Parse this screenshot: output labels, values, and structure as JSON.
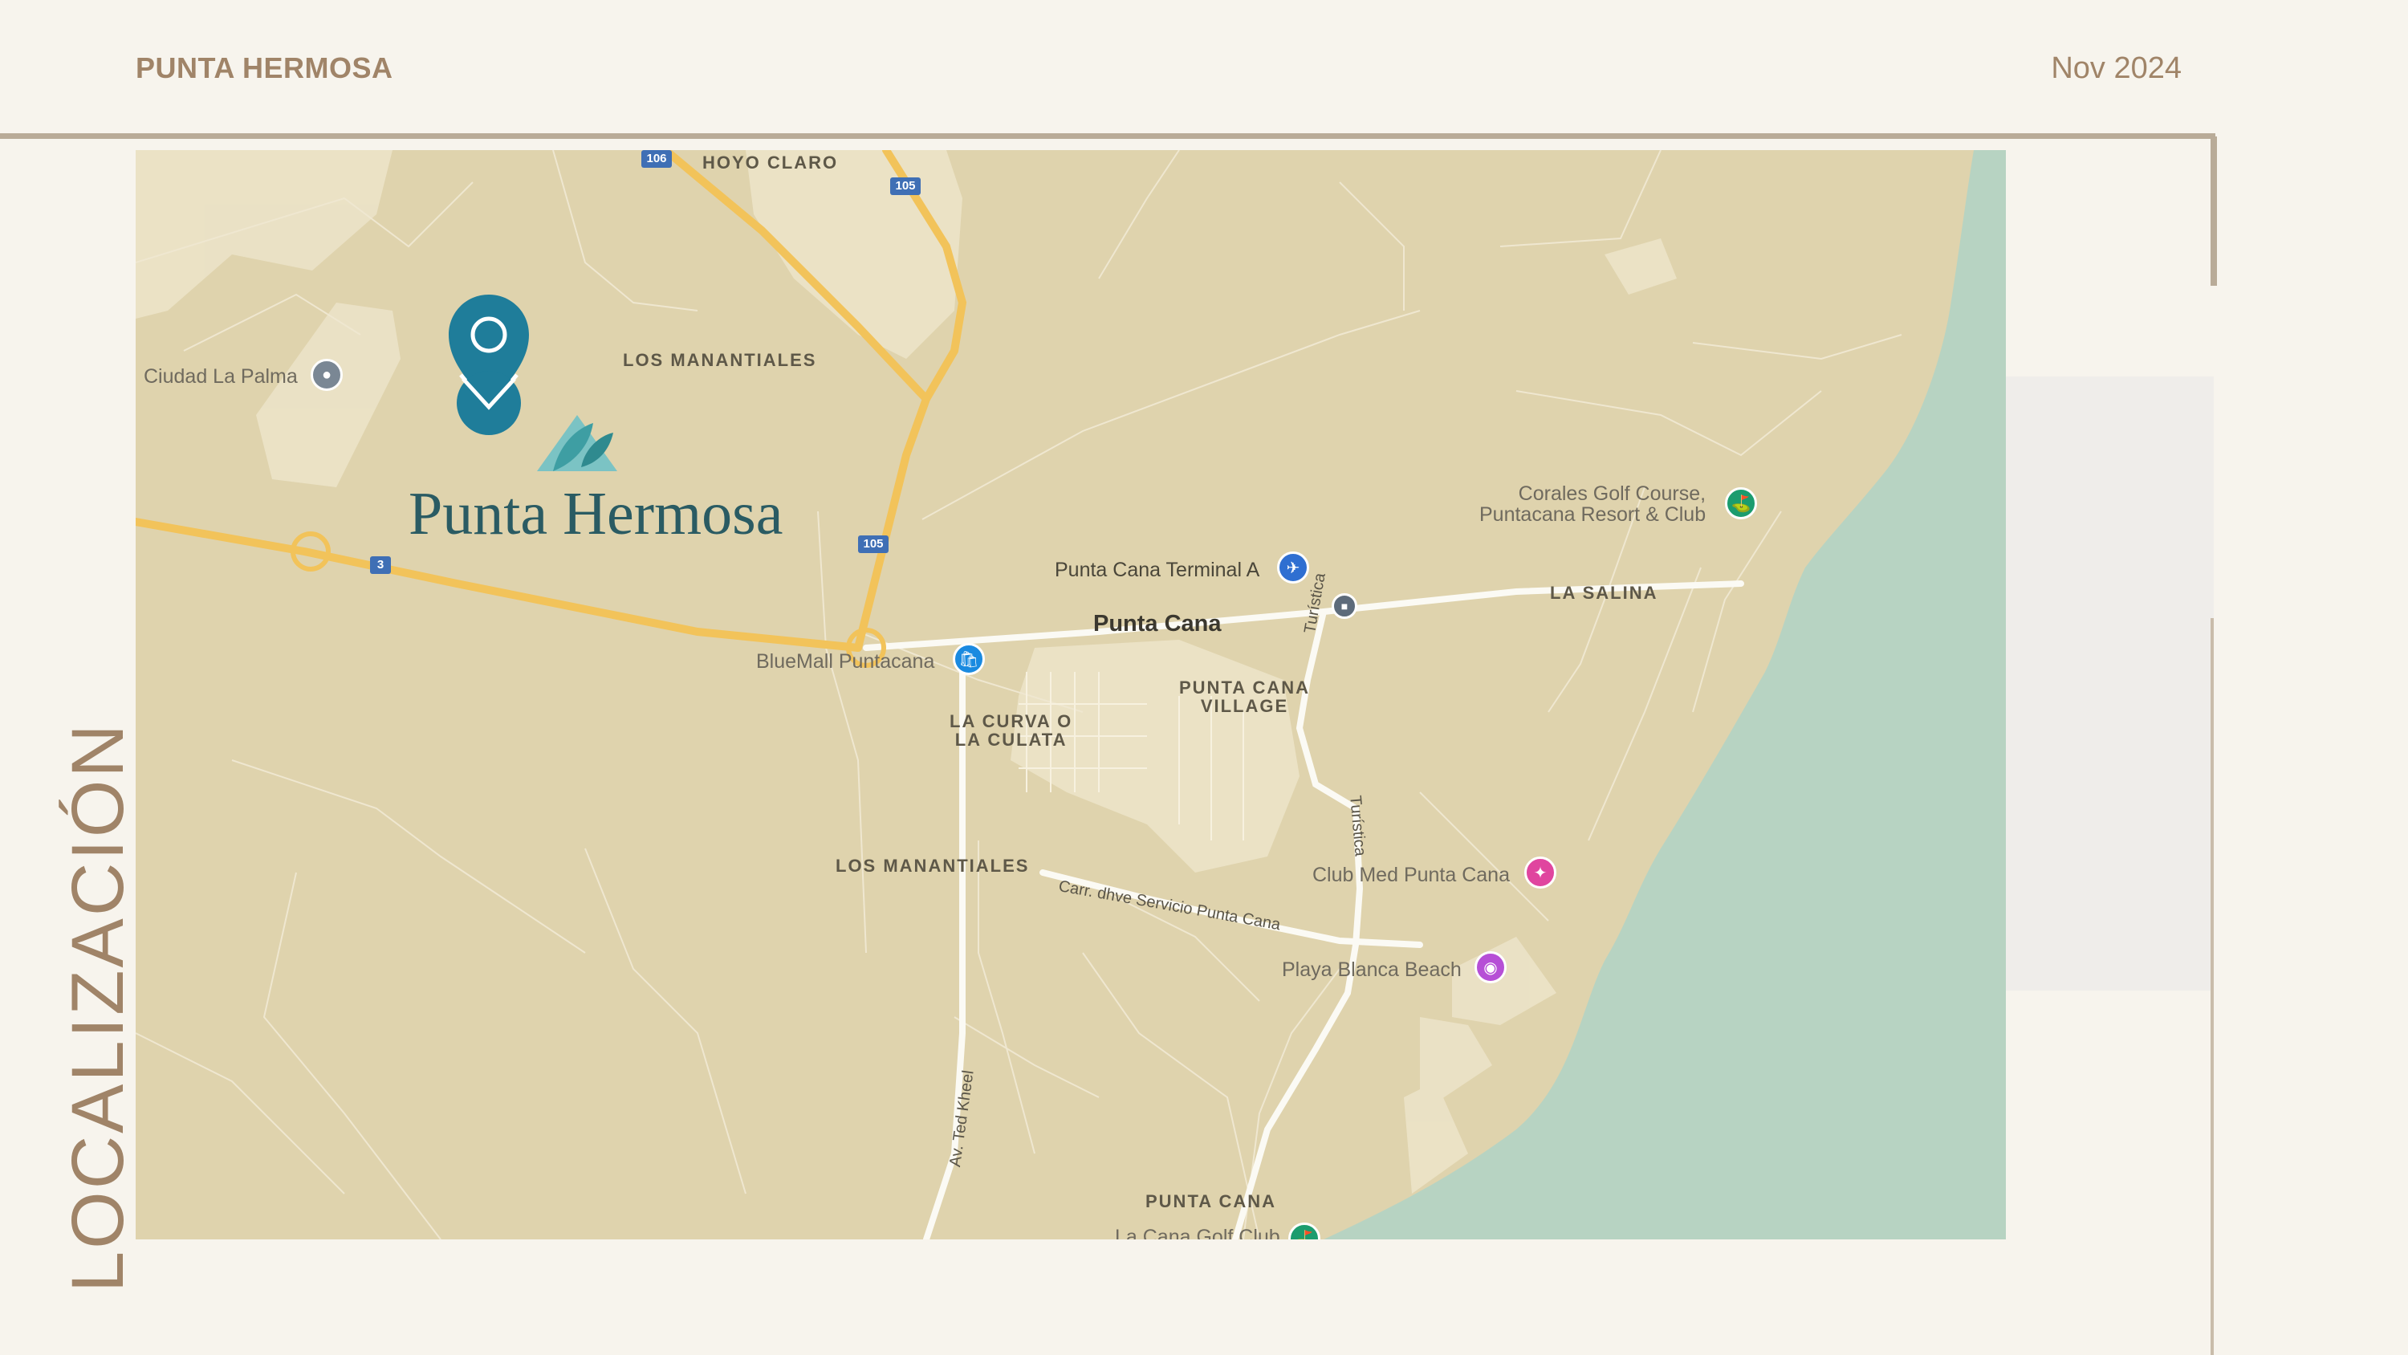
{
  "header": {
    "brand": "PUNTA HERMOSA",
    "date": "Nov 2024"
  },
  "side_title": "LOCALIZACIÓN",
  "map": {
    "logo_text": "Punta Hermosa",
    "areas": {
      "hoyo_claro": "HOYO CLARO",
      "los_manantiales_top": "LOS MANANTIALES",
      "la_salina": "LA SALINA",
      "punta_cana_village_1": "PUNTA CANA",
      "punta_cana_village_2": "VILLAGE",
      "la_curva_1": "LA CURVA O",
      "la_curva_2": "LA CULATA",
      "los_manantiales_bottom": "LOS MANANTIALES",
      "punta_cana_area": "PUNTA CANA"
    },
    "city": "Punta Cana",
    "pois": {
      "ciudad_la_palma": "Ciudad La Palma",
      "airport": "Punta Cana Terminal A",
      "bluemall": "BlueMall Puntacana",
      "golf_1": "Corales Golf Course,",
      "golf_2": "Puntacana Resort & Club",
      "club_med": "Club Med Punta Cana",
      "playa_blanca": "Playa Blanca Beach",
      "golf_bottom": "La Cana Golf Club"
    },
    "roads": {
      "turistica_1": "Turística",
      "turistica_2": "Turística",
      "carr_servicio": "Carr. dhve Servicio Punta Cana",
      "ted_kheel": "Av. Ted Kheel"
    },
    "shields": {
      "r106": "106",
      "r105a": "105",
      "r105b": "105",
      "r3": "3"
    },
    "colors": {
      "land": "#dfd3ad",
      "sea": "#b7d3c2",
      "highway": "#f2c35a",
      "pin": "#1f7d9a",
      "brand": "#a08468"
    }
  }
}
